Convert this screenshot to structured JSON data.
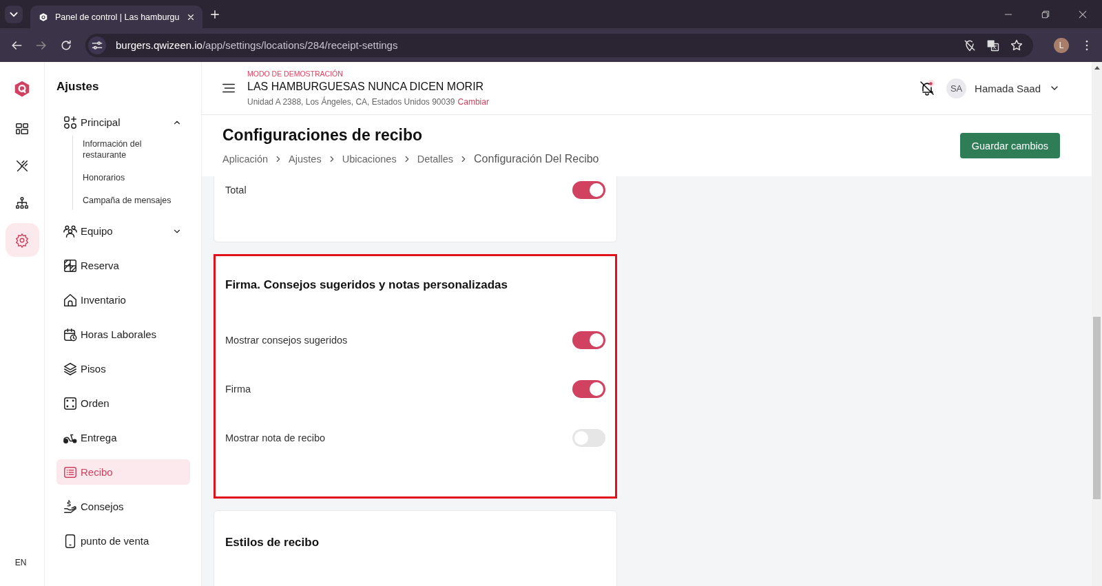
{
  "browser": {
    "tabs": [
      {
        "title": "Panel de control | Las hamburgu",
        "selected": true
      }
    ],
    "url_host": "burgers.qwizeen.io",
    "url_path": "/app/settings/locations/284/receipt-settings",
    "profile_initial": "L"
  },
  "rail": {
    "items": [
      {
        "selected": false
      },
      {
        "selected": false
      },
      {
        "selected": false
      },
      {
        "selected": true
      }
    ],
    "language": "EN"
  },
  "sidebar": {
    "title": "Ajustes",
    "items": [
      {
        "label": "Principal",
        "selected": false,
        "expanded": true,
        "children": [
          {
            "label": "Información del restaurante"
          },
          {
            "label": "Honorarios"
          },
          {
            "label": "Campaña de mensajes"
          }
        ]
      },
      {
        "label": "Equipo",
        "selected": false,
        "expanded": false
      },
      {
        "label": "Reserva",
        "selected": false
      },
      {
        "label": "Inventario",
        "selected": false
      },
      {
        "label": "Horas Laborales",
        "selected": false
      },
      {
        "label": "Pisos",
        "selected": false
      },
      {
        "label": "Orden",
        "selected": false
      },
      {
        "label": "Entrega",
        "selected": false
      },
      {
        "label": "Recibo",
        "selected": true
      },
      {
        "label": "Consejos",
        "selected": false
      },
      {
        "label": "punto de venta",
        "selected": false
      }
    ]
  },
  "header": {
    "demo_label": "MODO DE DEMOSTRACIÓN",
    "restaurant": "LAS HAMBURGUESAS NUNCA DICEN MORIR",
    "address": "Unidad A 2388, Los Ángeles, CA, Estados Unidos 90039",
    "change_link": "Cambiar",
    "user_initials": "SA",
    "user_name": "Hamada Saad"
  },
  "page": {
    "title": "Configuraciones de recibo",
    "breadcrumbs": [
      "Aplicación",
      "Ajustes",
      "Ubicaciones",
      "Detalles",
      "Configuración Del Recibo"
    ],
    "save_button": "Guardar cambios"
  },
  "sections": [
    {
      "highlighted": false,
      "rows": [
        {
          "label": "Total",
          "on": true
        }
      ]
    },
    {
      "title": "Firma. Consejos sugeridos y notas personalizadas",
      "highlighted": true,
      "rows": [
        {
          "label": "Mostrar consejos sugeridos",
          "on": true
        },
        {
          "label": "Firma",
          "on": true
        },
        {
          "label": "Mostrar nota de recibo",
          "on": false
        }
      ]
    },
    {
      "title": "Estilos de recibo",
      "highlighted": false
    }
  ]
}
